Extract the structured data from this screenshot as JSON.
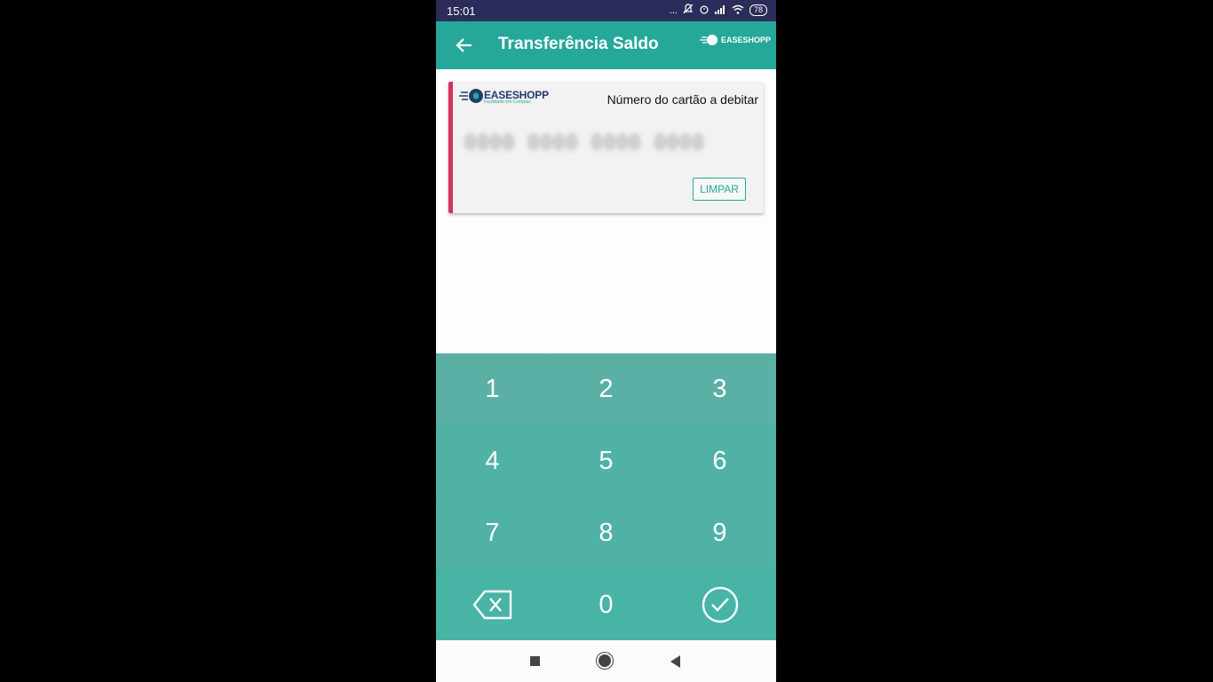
{
  "status_bar": {
    "time": "15:01",
    "dots": "...",
    "battery": "78"
  },
  "app_bar": {
    "title": "Transferência Saldo",
    "logo_text": "EASESHOPP"
  },
  "card": {
    "logo_text": "EASESHOPP",
    "logo_tagline": "Facilidade em Compras",
    "label": "Número do cartão a debitar",
    "number_masked": "0000 0000 0000 0000",
    "clear_label": "LIMPAR",
    "stripe_color": "#d8315b"
  },
  "keypad": {
    "keys": [
      "1",
      "2",
      "3",
      "4",
      "5",
      "6",
      "7",
      "8",
      "9"
    ],
    "zero": "0",
    "delete_icon": "backspace-icon",
    "confirm_icon": "check-circle-icon"
  },
  "colors": {
    "primary": "#25a89a",
    "status_bar": "#2b2c5a",
    "keypad": "#4fb2a5"
  }
}
